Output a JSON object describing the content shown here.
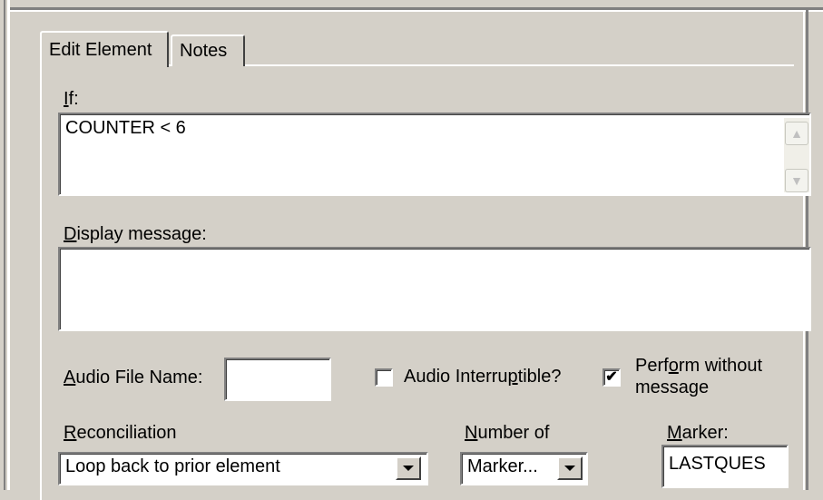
{
  "tabs": [
    {
      "label": "Edit Element",
      "active": true
    },
    {
      "label": "Notes",
      "active": false
    }
  ],
  "if_field": {
    "label": "If:",
    "mnemonic": "I",
    "label_rest": "f:",
    "value": "COUNTER < 6"
  },
  "display_message": {
    "label_mnemonic": "D",
    "label_rest": "isplay message:",
    "value": ""
  },
  "audio_file": {
    "label_mnemonic": "A",
    "label_rest": "udio File Name:",
    "value": ""
  },
  "audio_interruptible": {
    "label_before": "Audio Interru",
    "label_mnemonic": "p",
    "label_after": "tible?",
    "checked": false
  },
  "perform_without_message": {
    "line1_before": "Perf",
    "line1_mnemonic": "o",
    "line1_after": "rm without",
    "line2": "message",
    "checked": true,
    "check_glyph": "✔"
  },
  "reconciliation": {
    "label_mnemonic": "R",
    "label_rest": "econciliation",
    "selected": "Loop back to prior element"
  },
  "number_of": {
    "label_mnemonic": "N",
    "label_rest": "umber of",
    "selected": "Marker..."
  },
  "marker": {
    "label_mnemonic": "M",
    "label_rest": "arker:",
    "value": "LASTQUES"
  }
}
